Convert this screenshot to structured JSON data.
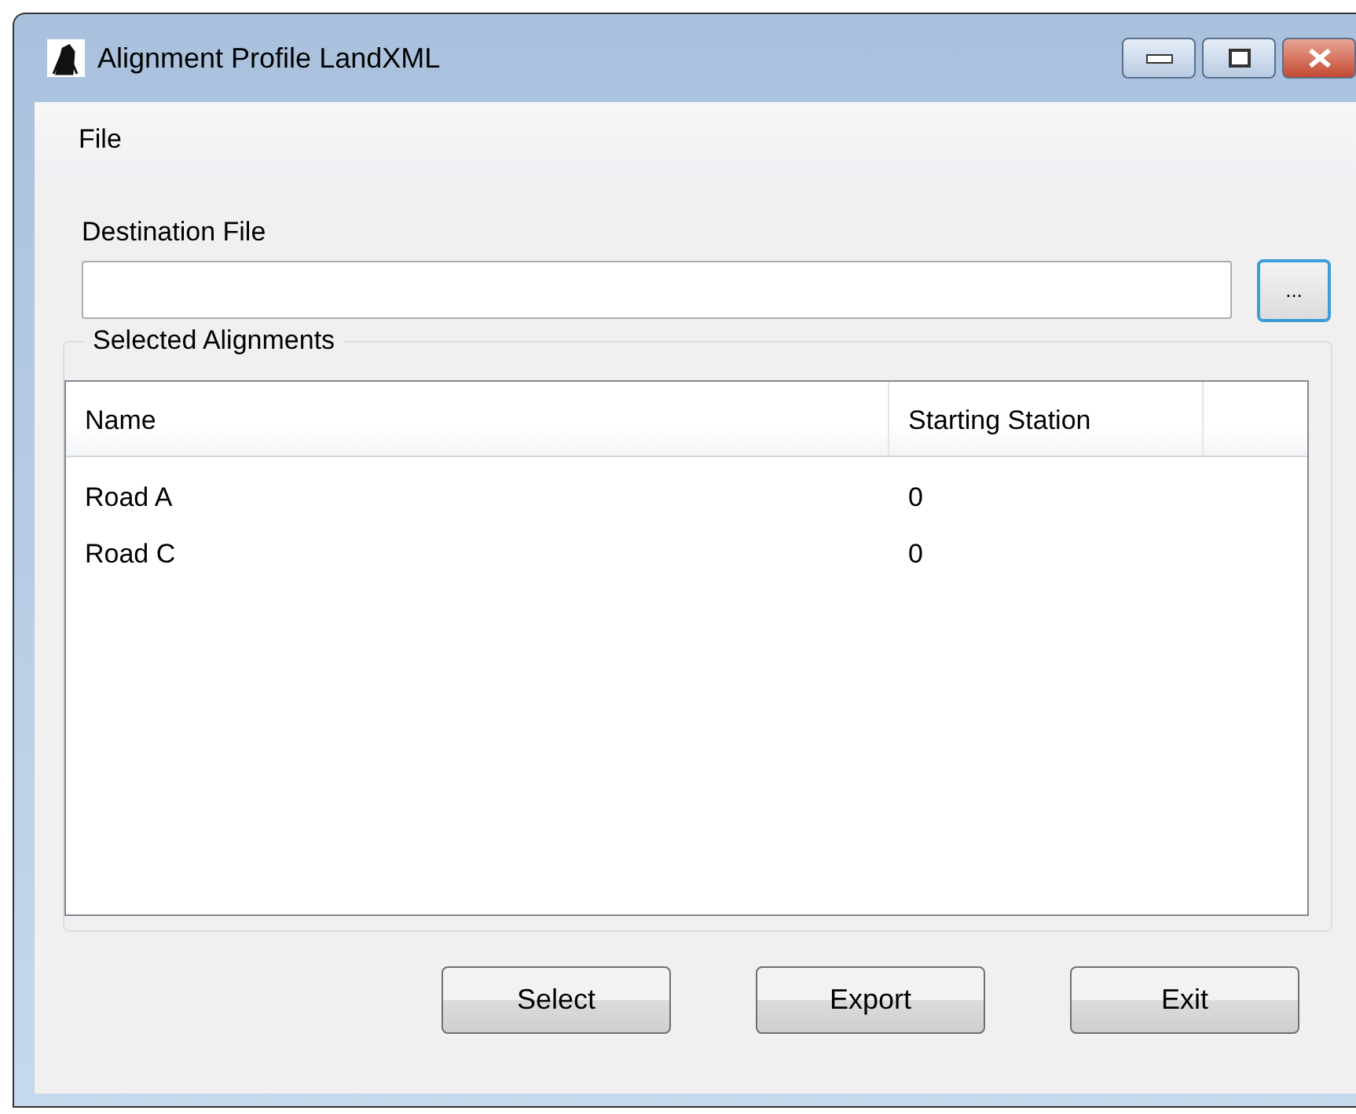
{
  "window": {
    "title": "Alignment Profile LandXML",
    "controls": [
      {
        "kind": "minimize"
      },
      {
        "kind": "maximize"
      },
      {
        "kind": "close"
      }
    ]
  },
  "menu": [
    "File"
  ],
  "destination": {
    "label": "Destination File",
    "browse_button": "..."
  },
  "group": {
    "title": "Selected Alignments",
    "columns": [
      "Name",
      "Starting Station"
    ],
    "rows": [
      [
        "Road A",
        "0"
      ],
      [
        "Road C",
        "0"
      ]
    ]
  },
  "buttons": [
    "Select",
    "Export",
    "Exit"
  ]
}
